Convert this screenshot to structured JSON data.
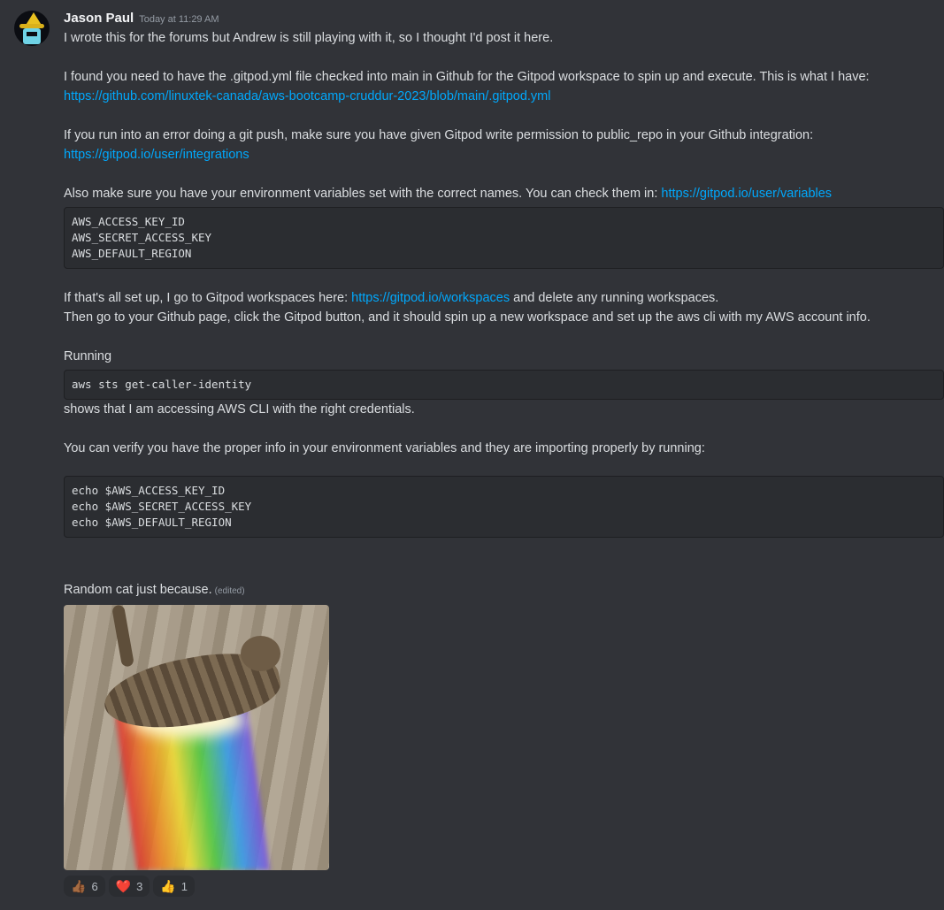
{
  "message": {
    "author": "Jason Paul",
    "timestamp": "Today at 11:29 AM",
    "lines": {
      "l1": "I wrote this for the forums but Andrew is still playing with it, so I thought I'd post it here.",
      "l2": "I found you need to have the .gitpod.yml file checked into main in Github for the Gitpod workspace to spin up and execute.  This is what I have:",
      "link1": "https://github.com/linuxtek-canada/aws-bootcamp-cruddur-2023/blob/main/.gitpod.yml",
      "l3": "If you run into an error doing a git push, make sure you have given Gitpod write permission to public_repo in your Github integration:",
      "link2": "https://gitpod.io/user/integrations",
      "l4": "Also make sure you have your environment variables set with the correct names.  You can check them in: ",
      "link3": "https://gitpod.io/user/variables",
      "code1": "AWS_ACCESS_KEY_ID\nAWS_SECRET_ACCESS_KEY\nAWS_DEFAULT_REGION",
      "l5a": "If that's all set up, I go to Gitpod workspaces here: ",
      "link4": "https://gitpod.io/workspaces",
      "l5b": " and delete any running workspaces.",
      "l6": "Then go to your Github page, click the Gitpod button, and it should spin up a new workspace and set up the aws cli with my AWS account info.",
      "l7": "Running",
      "code2": "aws sts get-caller-identity",
      "l8": " shows that I am accessing AWS CLI with the right credentials.",
      "l9": "You can verify you have the proper info in your environment variables and they are importing properly by running:",
      "code3": "echo $AWS_ACCESS_KEY_ID\necho $AWS_SECRET_ACCESS_KEY\necho $AWS_DEFAULT_REGION",
      "l10": "Random cat just because.",
      "edited": "(edited)"
    },
    "reactions": [
      {
        "emoji": "thumbs-up-dark-skin",
        "glyph": "👍🏾",
        "count": "6"
      },
      {
        "emoji": "red-heart",
        "glyph": "❤️",
        "count": "3"
      },
      {
        "emoji": "thumbs-up",
        "glyph": "👍",
        "count": "1"
      }
    ]
  },
  "colors": {
    "background": "#313338",
    "link": "#00a8fc",
    "code_bg": "#2b2d31"
  }
}
